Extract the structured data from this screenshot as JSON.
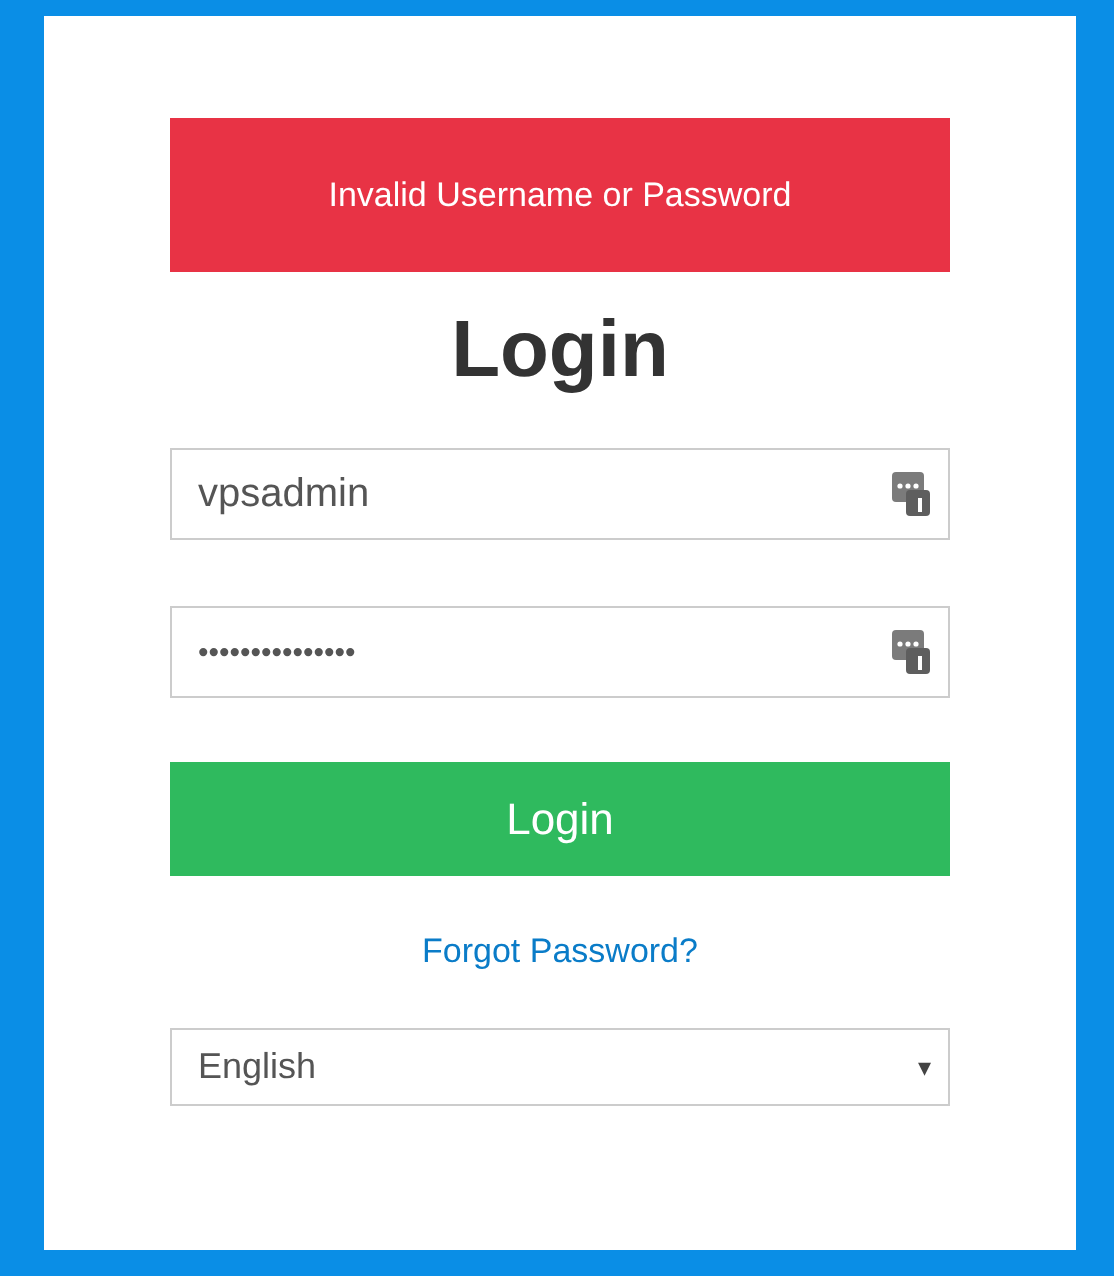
{
  "alert": {
    "message": "Invalid Username or Password"
  },
  "title": "Login",
  "username": {
    "value": "vpsadmin"
  },
  "password": {
    "value": "•••••••••••••••"
  },
  "login_button": {
    "label": "Login"
  },
  "forgot_link": {
    "label": "Forgot Password?"
  },
  "language": {
    "value": "English",
    "caret": "▾"
  }
}
